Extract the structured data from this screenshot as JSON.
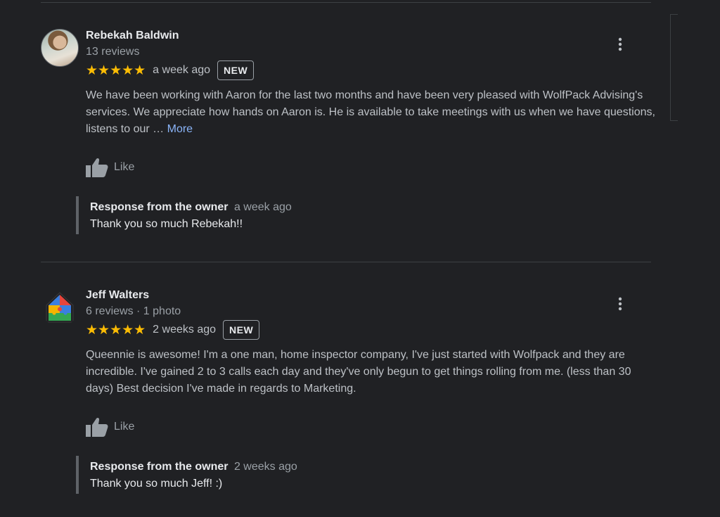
{
  "reviews": [
    {
      "author": "Rebekah Baldwin",
      "meta": "13 reviews",
      "stars": "★★★★★",
      "date": "a week ago",
      "badge": "NEW",
      "text": "We have been working with Aaron for the last two months and have been very pleased with WolfPack Advising's services. We appreciate how hands on Aaron is. He is available to take meetings with us when we have questions, listens to our … ",
      "more_label": "More",
      "like_label": "Like",
      "response": {
        "title": "Response from the owner",
        "date": "a week ago",
        "text": "Thank you so much Rebekah!!"
      }
    },
    {
      "author": "Jeff Walters",
      "meta": "6 reviews · 1 photo",
      "stars": "★★★★★",
      "date": "2 weeks ago",
      "badge": "NEW",
      "text": "Queennie is awesome! I'm a one man, home inspector company,  I've just started with Wolfpack and they are incredible. I've gained 2 to 3 calls each day and they've only begun to get things rolling from me. (less than 30 days) Best decision I've made in regards to Marketing.",
      "like_label": "Like",
      "response": {
        "title": "Response from the owner",
        "date": "2 weeks ago",
        "text": "Thank you so much Jeff! :)"
      }
    }
  ],
  "colors": {
    "background": "#202124",
    "star": "#fbbc04",
    "link": "#8ab4f8",
    "muted": "#9aa0a6"
  },
  "icons": {
    "menu": "more-vert-icon",
    "like": "thumbs-up-icon",
    "avatar_2": "house-puzzle-icon"
  }
}
